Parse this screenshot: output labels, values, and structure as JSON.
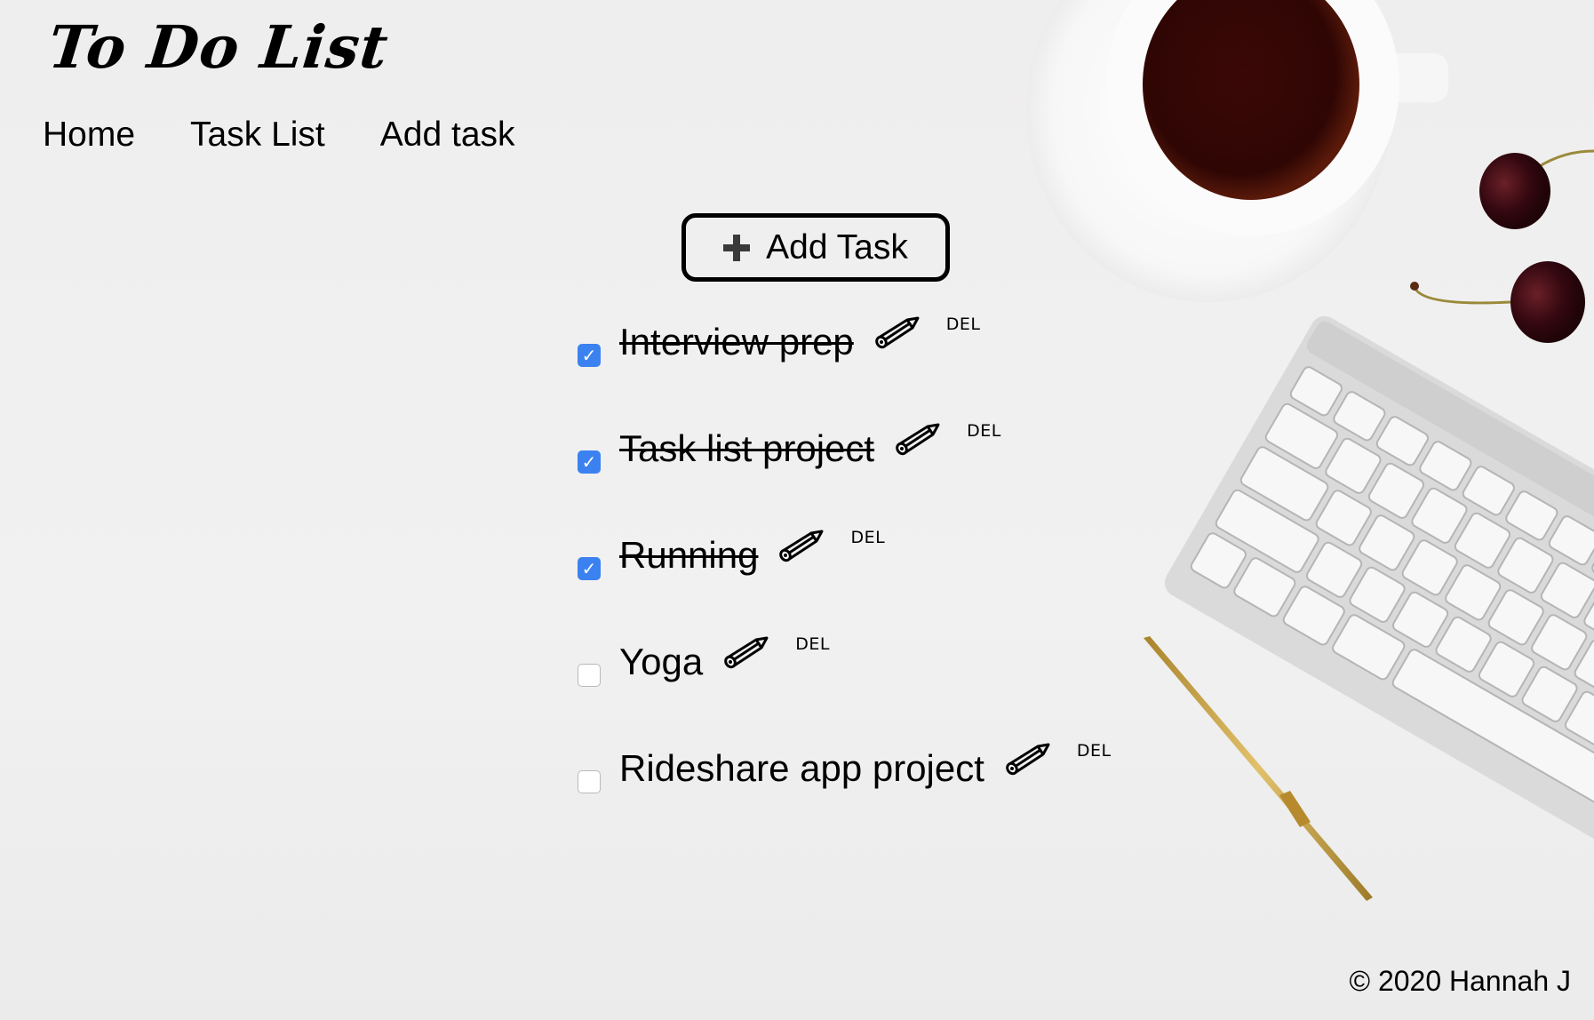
{
  "app": {
    "title": "To Do List"
  },
  "nav": {
    "items": [
      {
        "label": "Home"
      },
      {
        "label": "Task List"
      },
      {
        "label": "Add task"
      }
    ]
  },
  "toolbar": {
    "add_task_label": "Add Task",
    "add_task_icon": "plus-icon"
  },
  "tasks": [
    {
      "text": "Interview prep",
      "completed": true,
      "edit_icon": "pencil-icon",
      "delete_label": "DEL"
    },
    {
      "text": "Task list project",
      "completed": true,
      "edit_icon": "pencil-icon",
      "delete_label": "DEL"
    },
    {
      "text": "Running",
      "completed": true,
      "edit_icon": "pencil-icon",
      "delete_label": "DEL"
    },
    {
      "text": "Yoga",
      "completed": false,
      "edit_icon": "pencil-icon",
      "delete_label": "DEL"
    },
    {
      "text": "Rideshare app project",
      "completed": false,
      "edit_icon": "pencil-icon",
      "delete_label": "DEL"
    }
  ],
  "footer": {
    "copyright": "© 2020 Hannah J"
  },
  "colors": {
    "background": "#f0f0f0",
    "checkbox_checked": "#3b82f0",
    "text": "#000000",
    "coffee": "#3a0a07",
    "cherry": "#3b0a10",
    "pen_gold": "#c9a448",
    "keyboard": "#d9d9d9"
  },
  "check_glyph": "✓"
}
